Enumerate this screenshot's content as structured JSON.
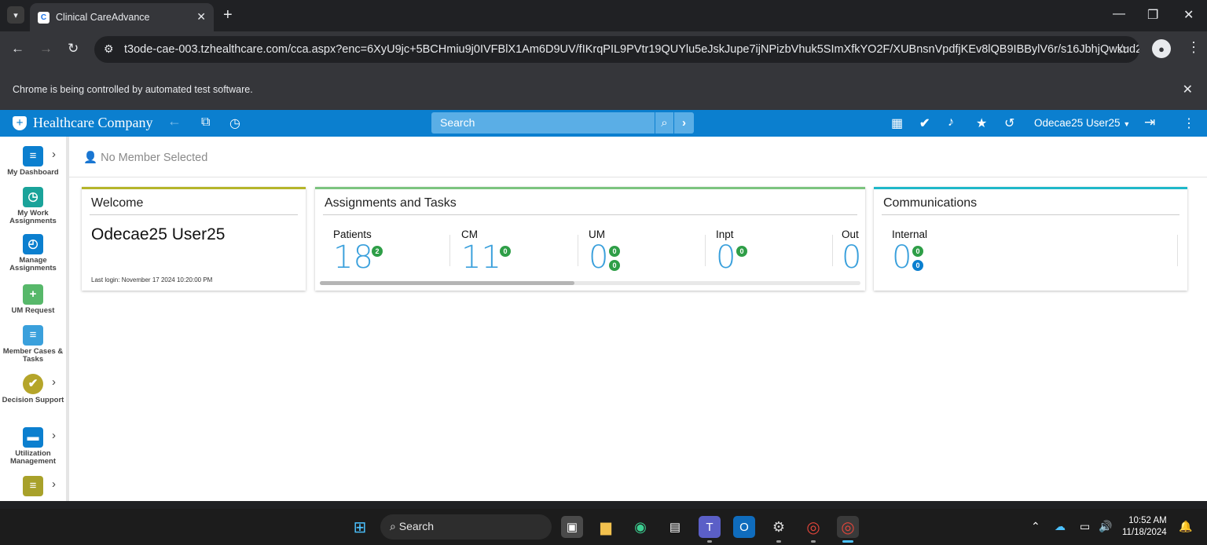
{
  "browser": {
    "tab_title": "Clinical CareAdvance",
    "url": "t3ode-cae-003.tzhealthcare.com/cca.aspx?enc=6XyU9jc+5BCHmiu9j0IVFBlX1Am6D9UV/fIKrqPIL9PVtr19QUYlu5eJskJupe7ijNPizbVhuk5SImXfkYO2F/XUBnsnVpdfjKEv8lQB9IBBylV6r/s16JbhjQwkud2eVIu...",
    "infobar_text": "Chrome is being controlled by automated test software."
  },
  "app": {
    "brand": "Healthcare Company",
    "search_placeholder": "Search",
    "user_name": "Odecae25 User25",
    "member_status": "No Member Selected"
  },
  "sidebar": {
    "items": [
      {
        "label": "My Dashboard",
        "color": "#0b7fcf"
      },
      {
        "label": "My Work Assignments",
        "color": "#1aa39a"
      },
      {
        "label": "Manage Assignments",
        "color": "#0b7fcf"
      },
      {
        "label": "UM Request",
        "color": "#57b86a"
      },
      {
        "label": "Member Cases & Tasks",
        "color": "#3aa0dc"
      },
      {
        "label": "Decision Support",
        "color": "#b5a52a"
      },
      {
        "label": "Utilization Management",
        "color": "#0b7fcf"
      },
      {
        "label": "",
        "color": "#a8a12a"
      }
    ]
  },
  "welcome": {
    "title": "Welcome",
    "name": "Odecae25 User25",
    "last_login": "Last login: November 17 2024 10:20:00 PM"
  },
  "assignments": {
    "title": "Assignments and Tasks",
    "stats": [
      {
        "label": "Patients",
        "value": "18",
        "badges": [
          "2"
        ]
      },
      {
        "label": "CM",
        "value": "11",
        "badges": [
          "0"
        ]
      },
      {
        "label": "UM",
        "value": "0",
        "badges": [
          "0",
          "0"
        ]
      },
      {
        "label": "Inpt",
        "value": "0",
        "badges": [
          "0"
        ]
      },
      {
        "label": "Out",
        "value": "0",
        "badges": []
      }
    ]
  },
  "communications": {
    "title": "Communications",
    "stats": [
      {
        "label": "Internal",
        "value": "0",
        "badges": [
          "0",
          "0"
        ]
      }
    ]
  },
  "taskbar": {
    "search_label": "Search",
    "time": "10:52 AM",
    "date": "11/18/2024"
  },
  "colors": {
    "app_bar": "#0b7fcf",
    "welcome_accent": "#b5b52a",
    "assignments_accent": "#7cc47f",
    "communications_accent": "#1fb8c9",
    "stat_value": "#3aa0dc"
  }
}
